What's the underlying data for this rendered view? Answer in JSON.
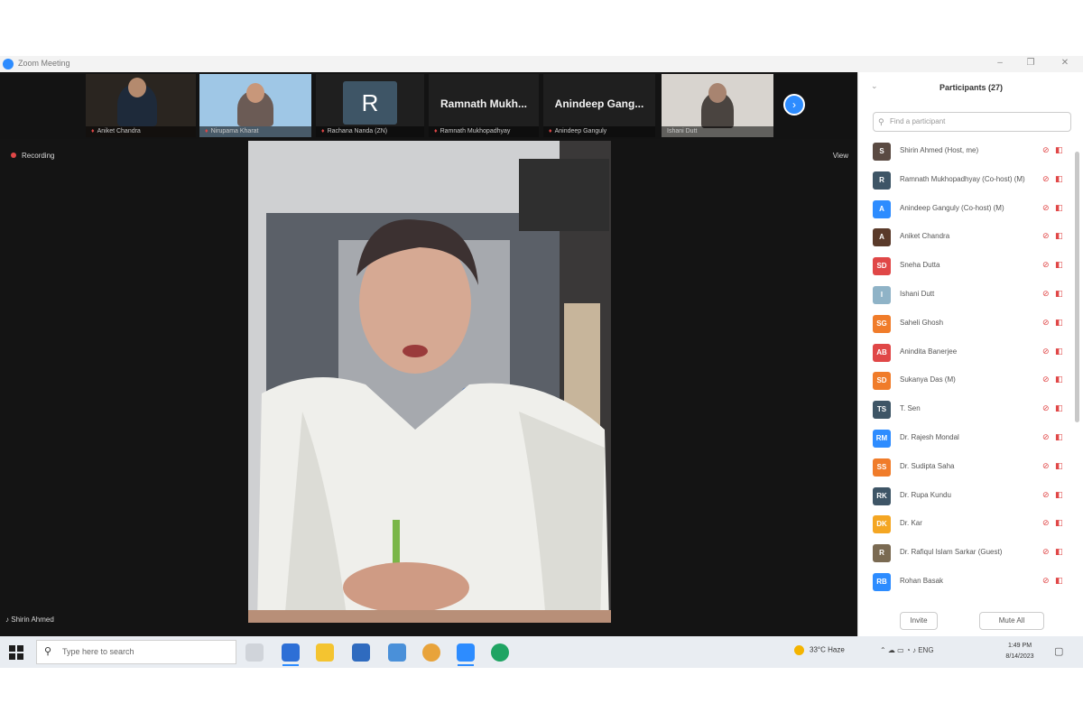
{
  "window": {
    "title": "Zoom Meeting",
    "controls": [
      "–",
      "❐",
      "✕"
    ]
  },
  "thumbnails": [
    {
      "name": "Aniket Chandra"
    },
    {
      "name": "Nirupama Kharat"
    },
    {
      "name": "Rachana Nanda (ZN)",
      "initial": "R"
    },
    {
      "name": "Ramnath Mukhopadhyay",
      "label": "Ramnath Mukh..."
    },
    {
      "name": "Anindeep Ganguly",
      "label": "Anindeep Gang..."
    },
    {
      "name": "Ishani Dutt"
    }
  ],
  "recording_label": "Recording",
  "view_label": "View",
  "speaker_name": "Shirin Ahmed",
  "panel": {
    "title": "Participants (27)",
    "search_placeholder": "Find a participant",
    "participants": [
      {
        "name": "Shirin Ahmed (Host, me)",
        "initial": "S",
        "color": "#5a4a42"
      },
      {
        "name": "Ramnath Mukhopadhyay (Co-host) (M)",
        "initial": "R",
        "color": "#3e5566"
      },
      {
        "name": "Anindeep Ganguly (Co-host) (M)",
        "initial": "A",
        "color": "#2d8cff"
      },
      {
        "name": "Aniket Chandra",
        "initial": "A",
        "color": "#5a3a2a"
      },
      {
        "name": "Sneha Dutta",
        "initial": "SD",
        "color": "#e04747"
      },
      {
        "name": "Ishani Dutt",
        "initial": "I",
        "color": "#8fb3c7"
      },
      {
        "name": "Saheli Ghosh",
        "initial": "SG",
        "color": "#f07c2a"
      },
      {
        "name": "Anindita Banerjee",
        "initial": "AB",
        "color": "#e04747"
      },
      {
        "name": "Sukanya Das (M)",
        "initial": "SD",
        "color": "#f07c2a"
      },
      {
        "name": "T. Sen",
        "initial": "TS",
        "color": "#3e5566"
      },
      {
        "name": "Dr. Rajesh Mondal",
        "initial": "RM",
        "color": "#2d8cff"
      },
      {
        "name": "Dr. Sudipta Saha",
        "initial": "SS",
        "color": "#f07c2a"
      },
      {
        "name": "Dr. Rupa Kundu",
        "initial": "RK",
        "color": "#3e5566"
      },
      {
        "name": "Dr. Kar",
        "initial": "DK",
        "color": "#f4a623"
      },
      {
        "name": "Dr. Rafiqul Islam Sarkar (Guest)",
        "initial": "R",
        "color": "#7a6a52"
      },
      {
        "name": "Rohan Basak",
        "initial": "RB",
        "color": "#2d8cff"
      }
    ],
    "invite_label": "Invite",
    "mute_all_label": "Mute All"
  },
  "taskbar": {
    "search_placeholder": "Type here to search",
    "weather": "33°C  Haze",
    "time": "1:49 PM",
    "date": "8/14/2023"
  }
}
